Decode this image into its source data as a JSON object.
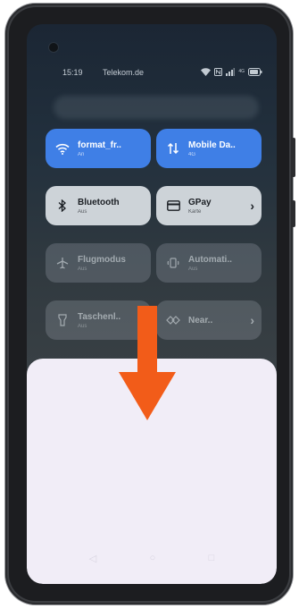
{
  "status_bar": {
    "time": "15:19",
    "carrier": "Telekom.de",
    "icons": [
      "wifi-icon",
      "nfc-icon",
      "signal-icon",
      "4g-icon",
      "battery-icon"
    ]
  },
  "tiles": [
    {
      "title": "format_fr..",
      "subtitle": "An",
      "icon": "wifi-icon",
      "state": "active"
    },
    {
      "title": "Mobile Da..",
      "subtitle": "4G",
      "icon": "mobile-data-icon",
      "state": "active"
    },
    {
      "title": "Bluetooth",
      "subtitle": "Aus",
      "icon": "bluetooth-icon",
      "state": "inactive"
    },
    {
      "title": "GPay",
      "subtitle": "Karte",
      "icon": "card-icon",
      "state": "inactive"
    },
    {
      "title": "Flugmodus",
      "subtitle": "Aus",
      "icon": "airplane-icon",
      "state": "dimmed"
    },
    {
      "title": "Automati..",
      "subtitle": "Aus",
      "icon": "auto-rotate-icon",
      "state": "dimmed"
    },
    {
      "title": "Taschenl..",
      "subtitle": "Aus",
      "icon": "flashlight-icon",
      "state": "dimmed"
    },
    {
      "title": "Near..",
      "subtitle": "",
      "icon": "nearby-share-icon",
      "state": "dimmed"
    }
  ],
  "colors": {
    "active_tile": "#3f7fe6",
    "inactive_tile": "#cdd3d8",
    "arrow": "#f25c19",
    "sheet": "#f1edf7"
  },
  "nav_bar": [
    "back-icon",
    "home-icon",
    "recents-icon"
  ]
}
